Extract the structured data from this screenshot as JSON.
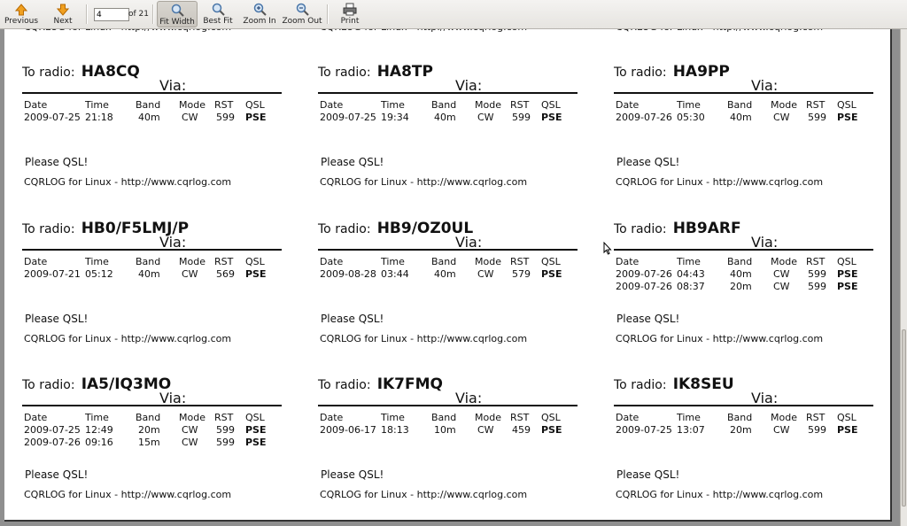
{
  "toolbar": {
    "previous_label": "Previous",
    "next_label": "Next",
    "page_value": "4",
    "page_total": "of 21",
    "fit_width_label": "Fit Width",
    "best_fit_label": "Best Fit",
    "zoom_in_label": "Zoom In",
    "zoom_out_label": "Zoom Out",
    "print_label": "Print"
  },
  "common": {
    "to_prefix": "To radio:",
    "via_label": "Via:",
    "please_text": "Please QSL!",
    "footer_text": "CQRLOG for Linux - http://www.cqrlog.com",
    "headers": {
      "date": "Date",
      "time": "Time",
      "band": "Band",
      "mode": "Mode",
      "rst": "RST",
      "qsl": "QSL"
    },
    "cut_text": "CQRLOG for Linux - http://www.cqrlog.com"
  },
  "labels": [
    {
      "callsign": "HA8CQ",
      "qsos": [
        {
          "date": "2009-07-25",
          "time": "21:18",
          "band": "40m",
          "mode": "CW",
          "rst": "599",
          "qsl": "PSE"
        }
      ]
    },
    {
      "callsign": "HA8TP",
      "qsos": [
        {
          "date": "2009-07-25",
          "time": "19:34",
          "band": "40m",
          "mode": "CW",
          "rst": "599",
          "qsl": "PSE"
        }
      ]
    },
    {
      "callsign": "HA9PP",
      "qsos": [
        {
          "date": "2009-07-26",
          "time": "05:30",
          "band": "40m",
          "mode": "CW",
          "rst": "599",
          "qsl": "PSE"
        }
      ]
    },
    {
      "callsign": "HB0/F5LMJ/P",
      "qsos": [
        {
          "date": "2009-07-21",
          "time": "05:12",
          "band": "40m",
          "mode": "CW",
          "rst": "569",
          "qsl": "PSE"
        }
      ]
    },
    {
      "callsign": "HB9/OZ0UL",
      "qsos": [
        {
          "date": "2009-08-28",
          "time": "03:44",
          "band": "40m",
          "mode": "CW",
          "rst": "579",
          "qsl": "PSE"
        }
      ]
    },
    {
      "callsign": "HB9ARF",
      "qsos": [
        {
          "date": "2009-07-26",
          "time": "04:43",
          "band": "40m",
          "mode": "CW",
          "rst": "599",
          "qsl": "PSE"
        },
        {
          "date": "2009-07-26",
          "time": "08:37",
          "band": "20m",
          "mode": "CW",
          "rst": "599",
          "qsl": "PSE"
        }
      ]
    },
    {
      "callsign": "IA5/IQ3MO",
      "qsos": [
        {
          "date": "2009-07-25",
          "time": "12:49",
          "band": "20m",
          "mode": "CW",
          "rst": "599",
          "qsl": "PSE"
        },
        {
          "date": "2009-07-26",
          "time": "09:16",
          "band": "15m",
          "mode": "CW",
          "rst": "599",
          "qsl": "PSE"
        }
      ]
    },
    {
      "callsign": "IK7FMQ",
      "qsos": [
        {
          "date": "2009-06-17",
          "time": "18:13",
          "band": "10m",
          "mode": "CW",
          "rst": "459",
          "qsl": "PSE"
        }
      ]
    },
    {
      "callsign": "IK8SEU",
      "qsos": [
        {
          "date": "2009-07-25",
          "time": "13:07",
          "band": "20m",
          "mode": "CW",
          "rst": "599",
          "qsl": "PSE"
        }
      ]
    }
  ]
}
